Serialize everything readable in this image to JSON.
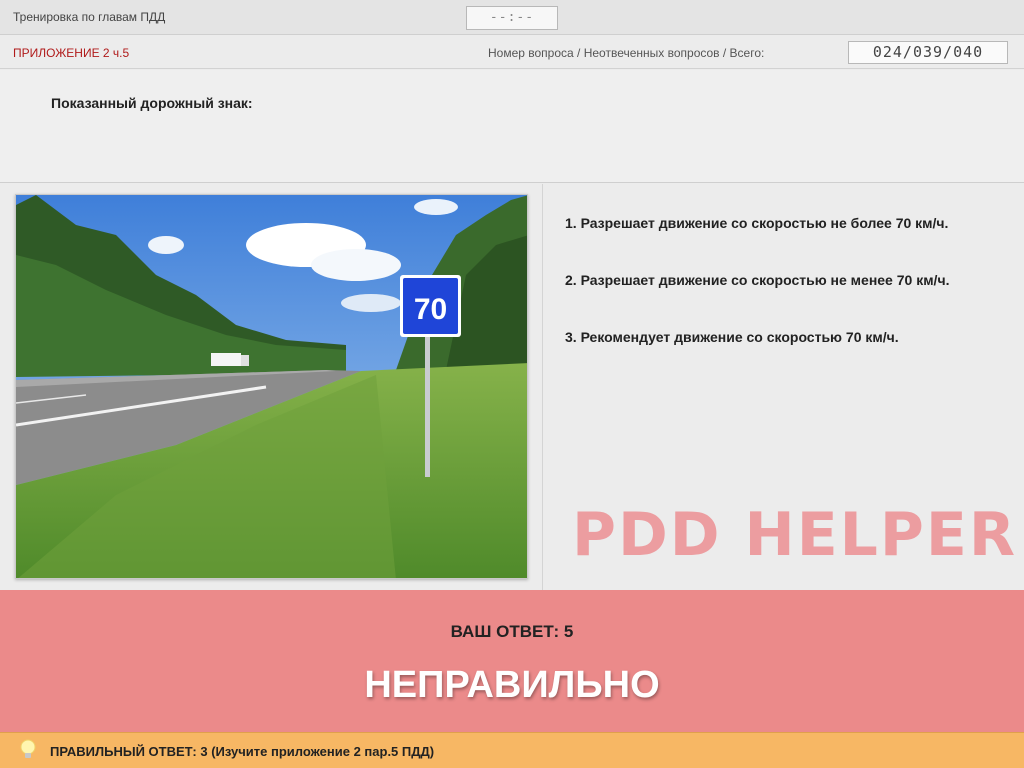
{
  "header": {
    "title": "Тренировка по главам ПДД",
    "timer": "--:--"
  },
  "subheader": {
    "section": "ПРИЛОЖЕНИЕ 2 ч.5",
    "counter_label": "Номер вопроса / Неотвеченных вопросов / Всего:",
    "counter_value": "024/039/040"
  },
  "question": {
    "text": "Показанный дорожный знак:",
    "sign_value": "70"
  },
  "answers": [
    {
      "label": "1.  Разрешает движение со скоростью не более 70 км/ч."
    },
    {
      "label": "2.  Разрешает движение со скоростью не менее 70 км/ч."
    },
    {
      "label": "3.  Рекомендует движение со скоростью 70 км/ч."
    }
  ],
  "watermark": "PDD HELPER",
  "result": {
    "your_answer": "ВАШ  ОТВЕТ:   5",
    "verdict": "НЕПРАВИЛЬНО"
  },
  "footer": {
    "icon": "lightbulb-icon",
    "correct_answer": "ПРАВИЛЬНЫЙ ОТВЕТ:   3   (Изучите приложение 2 пар.5 ПДД)"
  },
  "colors": {
    "result_bg": "#eb8a8a",
    "footer_bg": "#f7b764",
    "section_label": "#b01a1a",
    "sign_blue": "#1f45d8"
  }
}
